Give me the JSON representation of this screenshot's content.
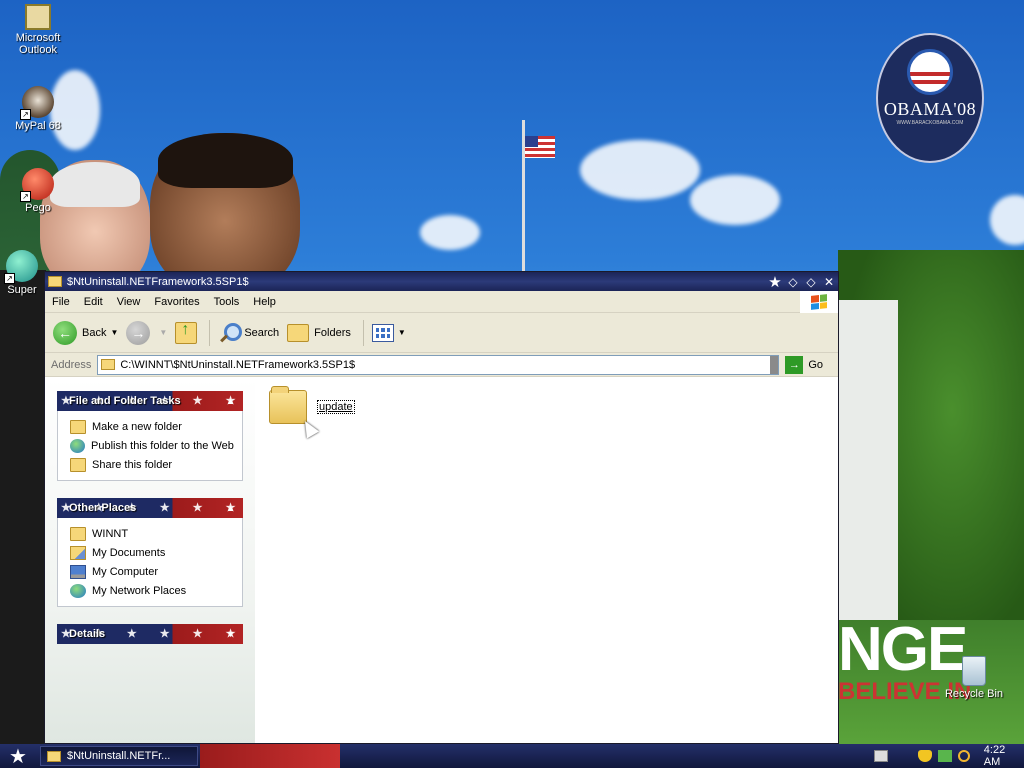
{
  "desktop": {
    "icons": [
      {
        "label": "Microsoft Outlook"
      },
      {
        "label": "MyPal 68"
      },
      {
        "label": "Pego"
      },
      {
        "label": "Super"
      }
    ],
    "recycle_bin": "Recycle Bin",
    "wallpaper_logo": {
      "text": "OBAMA'08",
      "sub": "WWW.BARACKOBAMA.COM"
    },
    "wallpaper_slogan": {
      "big": "NGE",
      "small": "BELIEVE IN"
    }
  },
  "window": {
    "title": "$NtUninstall.NETFramework3.5SP1$",
    "menu": [
      "File",
      "Edit",
      "View",
      "Favorites",
      "Tools",
      "Help"
    ],
    "toolbar": {
      "back": "Back",
      "search": "Search",
      "folders": "Folders"
    },
    "address": {
      "label": "Address",
      "value": "C:\\WINNT\\$NtUninstall.NETFramework3.5SP1$",
      "go": "Go"
    },
    "taskpane": {
      "file_folder_tasks": {
        "title": "File and Folder Tasks",
        "items": [
          "Make a new folder",
          "Publish this folder to the Web",
          "Share this folder"
        ]
      },
      "other_places": {
        "title": "Other Places",
        "items": [
          "WINNT",
          "My Documents",
          "My Computer",
          "My Network Places"
        ]
      },
      "details": {
        "title": "Details"
      }
    },
    "files": [
      {
        "name": "update"
      }
    ]
  },
  "taskbar": {
    "task_button": "$NtUninstall.NETFr...",
    "clock": "4:22 AM"
  }
}
